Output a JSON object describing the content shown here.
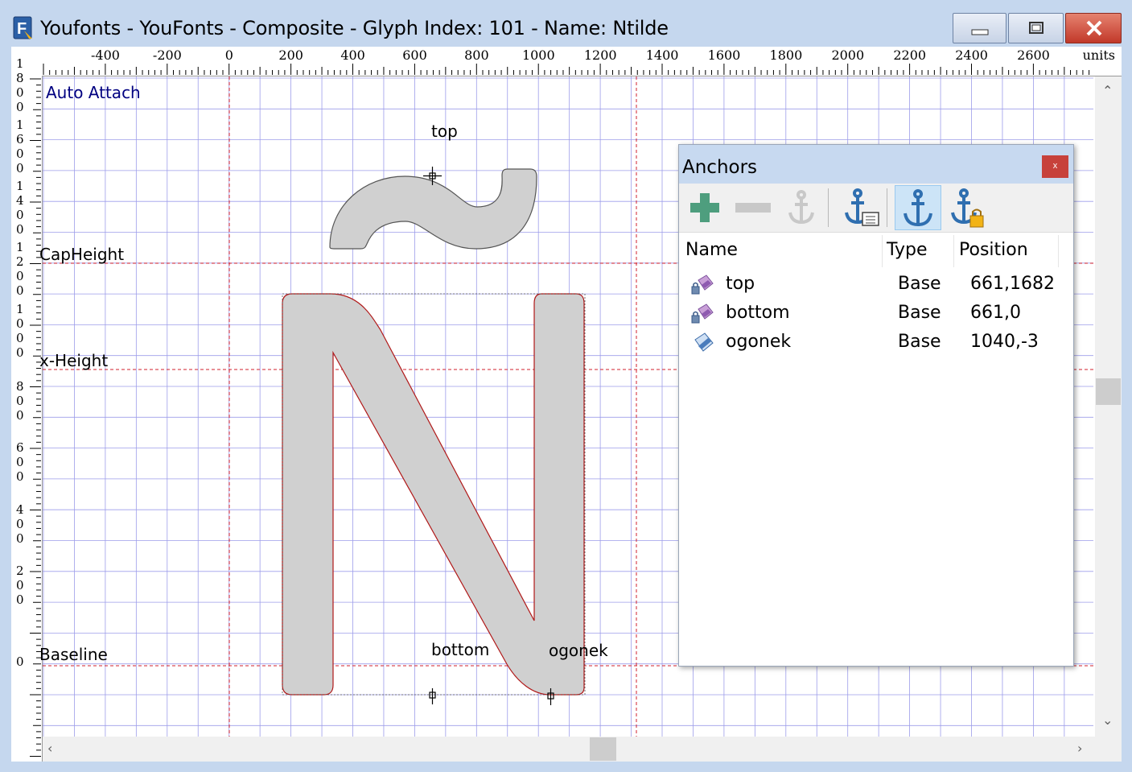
{
  "window": {
    "title": "Youfonts - YouFonts - Composite - Glyph Index: 101 - Name: Ntilde",
    "icon": "font-app-icon",
    "controls": {
      "minimize": "minimize-icon",
      "maximize": "maximize-icon",
      "close": "close-icon"
    }
  },
  "ruler": {
    "unit_label": "units",
    "h_ticks": [
      "-400",
      "-200",
      "0",
      "200",
      "400",
      "600",
      "800",
      "1000",
      "1200",
      "1400",
      "1600",
      "1800",
      "2000",
      "2200",
      "2400",
      "2600"
    ],
    "v_ticks": [
      "1800",
      "1600",
      "1400",
      "1200",
      "1000",
      "800",
      "600",
      "400",
      "200",
      "0"
    ]
  },
  "canvas": {
    "auto_attach": "Auto Attach",
    "guides": {
      "cap_height": "CapHeight",
      "x_height": "x-Height",
      "baseline": "Baseline"
    },
    "anchor_labels": {
      "top": "top",
      "bottom": "bottom",
      "ogonek": "ogonek"
    }
  },
  "anchors_panel": {
    "title": "Anchors",
    "close_glyph": "x",
    "toolbar": [
      "add-icon",
      "remove-icon",
      "edit-anchor-icon",
      "anchor-list-icon",
      "anchor-icon",
      "anchor-lock-icon"
    ],
    "columns": {
      "name": "Name",
      "type": "Type",
      "position": "Position"
    },
    "rows": [
      {
        "name": "top",
        "type": "Base",
        "position": "661,1682",
        "icon": "locked-eraser-icon"
      },
      {
        "name": "bottom",
        "type": "Base",
        "position": "661,0",
        "icon": "locked-eraser-icon"
      },
      {
        "name": "ogonek",
        "type": "Base",
        "position": "1040,-3",
        "icon": "eraser-icon"
      }
    ]
  },
  "colors": {
    "grid": "#9d9dea",
    "guide": "#d0202c",
    "glyph_fill": "#d0d0d0",
    "glyph_stroke": "#b01818",
    "titlebar": "#c5d7ee"
  }
}
